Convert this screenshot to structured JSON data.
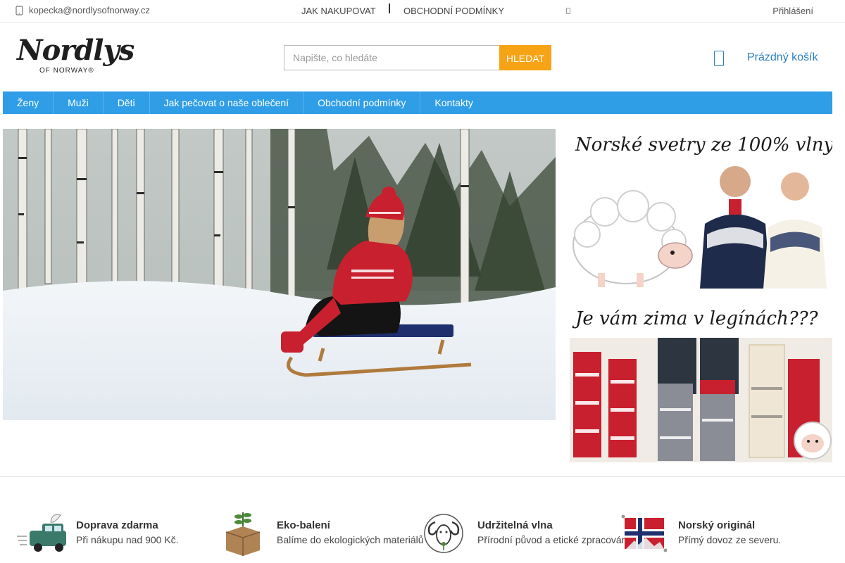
{
  "topbar": {
    "email": "kopecka@nordlysofnorway.cz",
    "link_how_to_buy": "JAK NAKUPOVAT",
    "link_terms": "OBCHODNÍ PODMÍNKY",
    "login": "Přihlášení"
  },
  "header": {
    "logo_text": "Nordlys",
    "logo_sub": "OF NORWAY®",
    "search_placeholder": "Napište, co hledáte",
    "search_button": "HLEDAT",
    "cart_label": "Prázdný košík"
  },
  "nav": {
    "items": [
      {
        "label": "Ženy"
      },
      {
        "label": "Muži"
      },
      {
        "label": "Děti"
      },
      {
        "label": "Jak pečovat o naše oblečení"
      },
      {
        "label": "Obchodní podmínky"
      },
      {
        "label": "Kontakty"
      }
    ]
  },
  "banners": {
    "banner1_text": "Norské svetry ze 100% vlny",
    "banner2_text": "Je vám zima v legínách???"
  },
  "features": [
    {
      "icon": "delivery-van-icon",
      "title": "Doprava zdarma",
      "text": "Při nákupu nad 900 Kč."
    },
    {
      "icon": "eco-box-icon",
      "title": "Eko-balení",
      "text": "Balíme do ekologických materiálů"
    },
    {
      "icon": "ram-wool-icon",
      "title": "Udržitelná vlna",
      "text": "Přírodní původ a etické zpracování."
    },
    {
      "icon": "norway-flag-icon",
      "title": "Norský originál",
      "text": "Přímý dovoz ze severu."
    }
  ],
  "colors": {
    "nav_blue": "#2f9ee7",
    "search_orange": "#f7a316",
    "cart_blue": "#2a7fbf",
    "sweater_red": "#c8202e"
  }
}
